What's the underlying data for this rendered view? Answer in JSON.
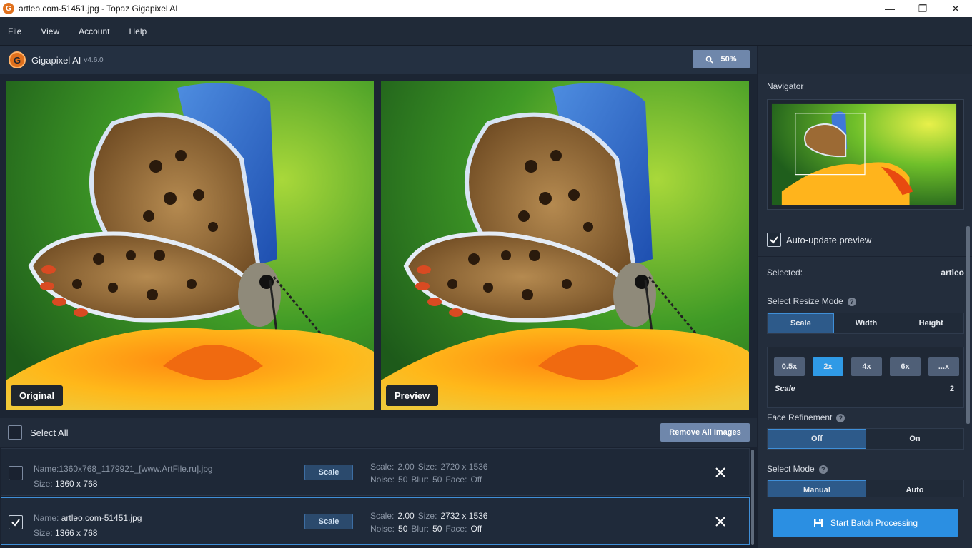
{
  "window": {
    "title": "artleo.com-51451.jpg - Topaz Gigapixel AI",
    "app_icon_letter": "G",
    "minimize": "—",
    "maximize": "❐",
    "close": "✕"
  },
  "menu": [
    "File",
    "View",
    "Account",
    "Help"
  ],
  "header": {
    "logo_letter": "G",
    "app_name": "Gigapixel AI",
    "version": "v4.6.0",
    "zoom": "50%"
  },
  "preview": {
    "original_label": "Original",
    "preview_label": "Preview"
  },
  "list_toolbar": {
    "select_all": "Select All",
    "remove_all": "Remove All Images"
  },
  "files": [
    {
      "name_label": "Name:",
      "name": "1360x768_1179921_[www.ArtFile.ru].jpg",
      "size_label": "Size:",
      "size": "1360 x 768",
      "mode": "Scale",
      "scale_label": "Scale:",
      "scale": "2.00",
      "out_size_label": "Size:",
      "out_size": "2720 x 1536",
      "noise_label": "Noise:",
      "noise": "50",
      "blur_label": "Blur:",
      "blur": "50",
      "face_label": "Face:",
      "face": "Off",
      "checked": false
    },
    {
      "name_label": "Name:",
      "name": "artleo.com-51451.jpg",
      "size_label": "Size:",
      "size": "1366 x 768",
      "mode": "Scale",
      "scale_label": "Scale:",
      "scale": "2.00",
      "out_size_label": "Size:",
      "out_size": "2732 x 1536",
      "noise_label": "Noise:",
      "noise": "50",
      "blur_label": "Blur:",
      "blur": "50",
      "face_label": "Face:",
      "face": "Off",
      "checked": true
    }
  ],
  "panel": {
    "navigator_title": "Navigator",
    "auto_update": "Auto-update preview",
    "selected_label": "Selected:",
    "selected_value": "artleo",
    "resize_mode_title": "Select Resize Mode",
    "resize_modes": [
      "Scale",
      "Width",
      "Height"
    ],
    "scale_options": [
      "0.5x",
      "2x",
      "4x",
      "6x",
      "...x"
    ],
    "scale_label": "Scale",
    "scale_value": "2",
    "face_refinement_title": "Face Refinement",
    "face_options": [
      "Off",
      "On"
    ],
    "select_mode_title": "Select Mode",
    "mode_options": [
      "Manual",
      "Auto"
    ],
    "help_glyph": "?",
    "batch_button": "Start Batch Processing"
  },
  "colors": {
    "accent": "#2f9ae6",
    "button_gray_blue": "#6f87ab",
    "app_orange": "#e0701c"
  }
}
